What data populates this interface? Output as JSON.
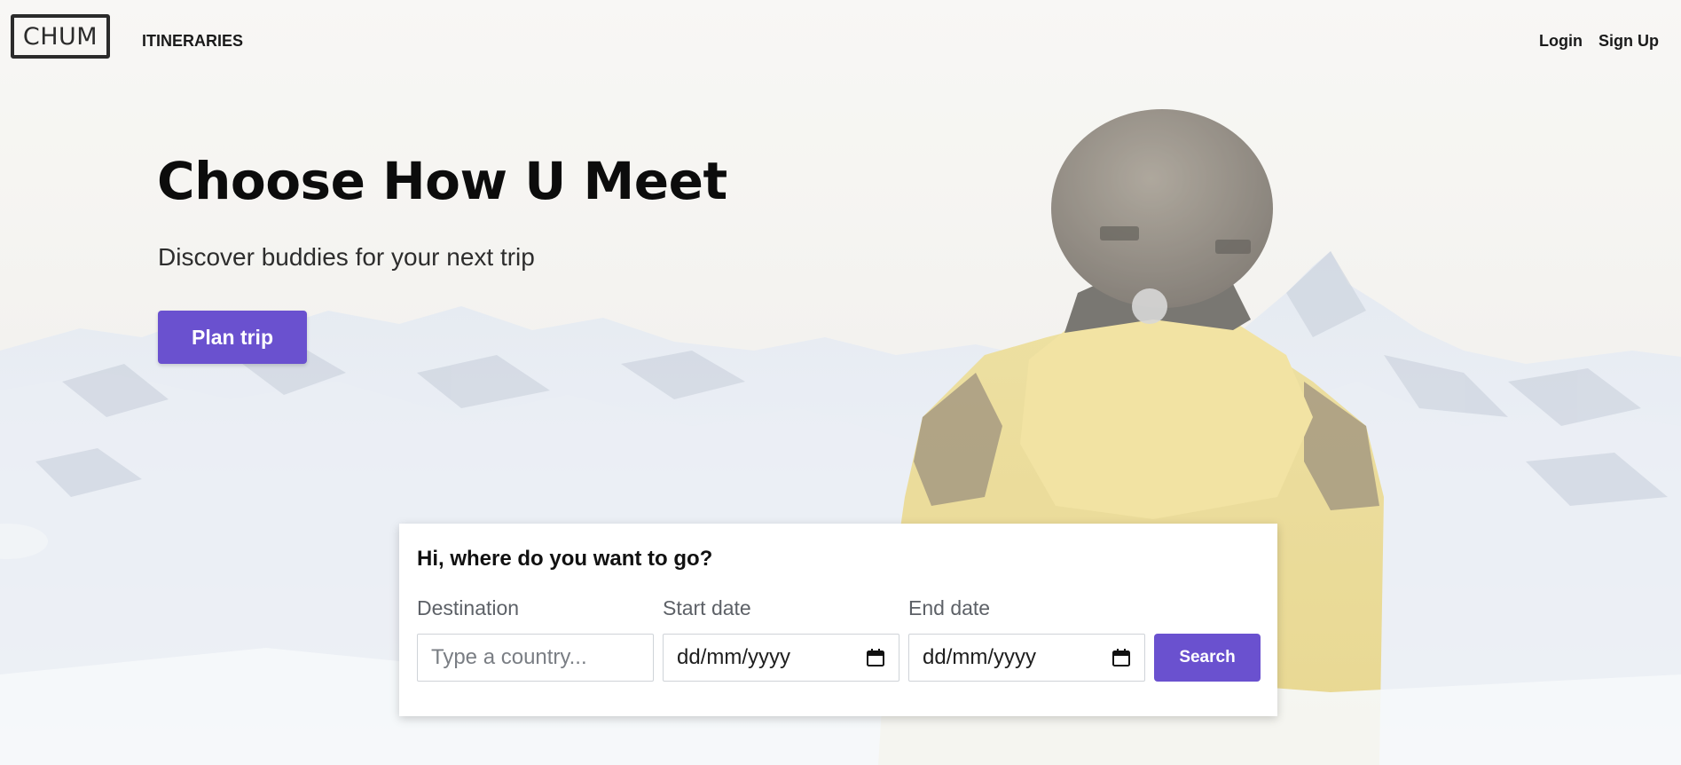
{
  "nav": {
    "logo": "CHUM",
    "itineraries": "ITINERARIES",
    "login": "Login",
    "signup": "Sign Up"
  },
  "hero": {
    "title": "Choose How U Meet",
    "subtitle": "Discover buddies for your next trip",
    "cta": "Plan trip"
  },
  "search": {
    "heading": "Hi, where do you want to go?",
    "destination_label": "Destination",
    "destination_placeholder": "Type a country...",
    "start_label": "Start date",
    "start_value": "dd/mm/yyyy",
    "end_label": "End date",
    "end_value": "dd/mm/yyyy",
    "button": "Search"
  },
  "icons": {
    "calendar": "calendar-icon"
  },
  "colors": {
    "accent": "#6a51cf",
    "text_dark": "#0c0c0c",
    "label_gray": "#5d6167",
    "jacket_yellow": "#ead27f"
  }
}
